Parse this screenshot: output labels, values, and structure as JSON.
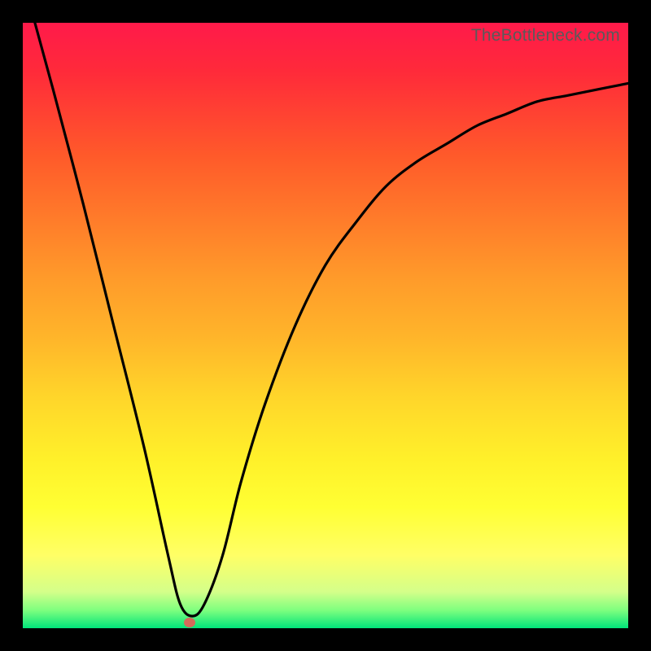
{
  "watermark": "TheBottleneck.com",
  "chart_data": {
    "type": "line",
    "title": "",
    "xlabel": "",
    "ylabel": "",
    "xlim": [
      0,
      1
    ],
    "ylim": [
      0,
      1
    ],
    "series": [
      {
        "name": "curve",
        "x": [
          0.02,
          0.05,
          0.1,
          0.15,
          0.2,
          0.24,
          0.26,
          0.28,
          0.3,
          0.33,
          0.36,
          0.4,
          0.45,
          0.5,
          0.55,
          0.6,
          0.65,
          0.7,
          0.75,
          0.8,
          0.85,
          0.9,
          0.95,
          1.0
        ],
        "y": [
          1.0,
          0.89,
          0.7,
          0.5,
          0.3,
          0.12,
          0.04,
          0.02,
          0.04,
          0.12,
          0.24,
          0.37,
          0.5,
          0.6,
          0.67,
          0.73,
          0.77,
          0.8,
          0.83,
          0.85,
          0.87,
          0.88,
          0.89,
          0.9
        ]
      }
    ],
    "marker": {
      "x": 0.275,
      "y": 0.01
    },
    "background": "red-yellow-green vertical gradient"
  }
}
